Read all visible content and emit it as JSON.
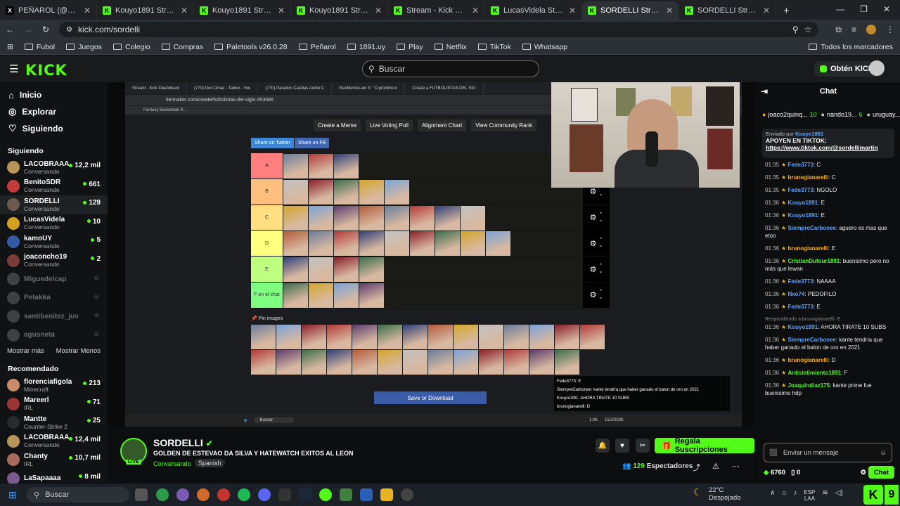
{
  "browser": {
    "tabs": [
      {
        "title": "PEÑAROL (@OficialCAP)",
        "fav": "X",
        "color": "#000"
      },
      {
        "title": "Kouyo1891 Stream - Watc",
        "fav": "K",
        "color": "#53fc18"
      },
      {
        "title": "Kouyo1891 Stream - Watc",
        "fav": "K",
        "color": "#53fc18"
      },
      {
        "title": "Kouyo1891 Stream - Watc",
        "fav": "K",
        "color": "#53fc18"
      },
      {
        "title": "Stream - Kick Dashboard",
        "fav": "K",
        "color": "#53fc18"
      },
      {
        "title": "LucasVidela Stream -",
        "fav": "K",
        "color": "#53fc18"
      },
      {
        "title": "SORDELLI Stream - W",
        "fav": "K",
        "color": "#53fc18"
      },
      {
        "title": "SORDELLI Stream - Kick D",
        "fav": "K",
        "color": "#53fc18"
      }
    ],
    "active_tab": 6,
    "url": "kick.com/sordelli",
    "bookmarks": [
      "Fubol",
      "Juegos",
      "Colegio",
      "Compras",
      "Paletools v26.0.28",
      "Peñarol",
      "1891.uy",
      "Play",
      "Netflix",
      "TikTok",
      "Whatsapp"
    ],
    "all_bookmarks": "Todos los marcadores"
  },
  "header": {
    "logo": "KICK",
    "search_placeholder": "Buscar",
    "get_kicks": "Obtén KICKs"
  },
  "sidebar": {
    "nav": [
      {
        "label": "Inicio",
        "icon": "home-icon"
      },
      {
        "label": "Explorar",
        "icon": "compass-icon"
      },
      {
        "label": "Siguiendo",
        "icon": "heart-icon"
      }
    ],
    "following_title": "Siguiendo",
    "following": [
      {
        "name": "LACOBRAAA",
        "sub": "Conversando",
        "viewers": "12,2 mil",
        "color": "#b79457"
      },
      {
        "name": "BenitoSDR",
        "sub": "Conversando",
        "viewers": "661",
        "color": "#c23b3b"
      },
      {
        "name": "SORDELLI",
        "sub": "Conversando",
        "viewers": "129",
        "color": "#6a5b4c"
      },
      {
        "name": "LucasVidela",
        "sub": "Conversando",
        "viewers": "10",
        "color": "#d3a21e"
      },
      {
        "name": "kamoUY",
        "sub": "Conversando",
        "viewers": "5",
        "color": "#3659a5"
      },
      {
        "name": "joaconcho19",
        "sub": "Conversando",
        "viewers": "2",
        "color": "#7a3c38"
      },
      {
        "name": "Miguedelcap",
        "sub": "",
        "viewers": "",
        "color": "#888"
      },
      {
        "name": "Petakka",
        "sub": "",
        "viewers": "",
        "color": "#888"
      },
      {
        "name": "santibenitez_juv",
        "sub": "",
        "viewers": "",
        "color": "#888"
      },
      {
        "name": "agusneta",
        "sub": "",
        "viewers": "",
        "color": "#888"
      }
    ],
    "show_more": "Mostrar más",
    "show_less": "Mostrar Menos",
    "recommended_title": "Recomendado",
    "recommended": [
      {
        "name": "florenciafigola",
        "sub": "Minecraft",
        "viewers": "213",
        "color": "#c88c6a"
      },
      {
        "name": "Mareerl",
        "sub": "IRL",
        "viewers": "71",
        "color": "#9b3434"
      },
      {
        "name": "Mantte",
        "sub": "Counter-Strike 2",
        "viewers": "25",
        "color": "#2a2a2a"
      },
      {
        "name": "LACOBRAAA",
        "sub": "Conversando",
        "viewers": "12,4 mil",
        "color": "#b79457"
      },
      {
        "name": "Chanty",
        "sub": "IRL",
        "viewers": "10,7 mil",
        "color": "#a66b5a"
      },
      {
        "name": "LaSapaaaa",
        "sub": "",
        "viewers": "8 mil",
        "color": "#7b5a8f"
      }
    ]
  },
  "stream_screen": {
    "tabs": [
      "Stream - Kick Dashboard",
      "(770) Don Omar - Taboo - You",
      "(770) Paradon Casillas Audio C",
      "GeoMemes en X: \"O próximo o",
      "Create a FUTBOLISTAS DEL SIG"
    ],
    "url": "tiermaker.com/create/futbolistas-del-siglo-353586",
    "bookmark": "Fantasy Basketball R...",
    "top_buttons": [
      "Create a Meme",
      "Live Voting Poll",
      "Alignment Chart",
      "View Community Rank"
    ],
    "share": [
      "Share on Twitter",
      "Share on FB"
    ],
    "tiers": [
      {
        "label": "A",
        "color": "#ff7f7f",
        "count": 3
      },
      {
        "label": "B",
        "color": "#ffbf7f",
        "count": 5
      },
      {
        "label": "C",
        "color": "#ffdf7f",
        "count": 8
      },
      {
        "label": "D",
        "color": "#ffff7f",
        "count": 9
      },
      {
        "label": "E",
        "color": "#bfff7f",
        "count": 4
      },
      {
        "label": "F en el chat",
        "color": "#7fff7f",
        "count": 4
      }
    ],
    "pin_images": "Pin images",
    "save_button": "Save or Download",
    "mini_chat": [
      "Fede3773: E",
      "SiempreCarbonee: kante tendría que haber ganado el balon de oro en 2021",
      "Kouyo1891: AHORA TIRATE 10 SUBS",
      "brunogianarelli: D"
    ],
    "taskbar_search": "Buscar",
    "clock": "1:36",
    "date": "15/2/2026"
  },
  "stream_info": {
    "name": "SORDELLI",
    "title": "GOLDEN DE ESTEVAO DA SILVA Y HATEWATCH EXITOS AL LEON",
    "category": "Conversando",
    "language": "Spanish",
    "live": "LIVE",
    "subscribe": "Regala Suscripciones",
    "viewers": "129",
    "viewers_label": "Espectadores"
  },
  "chat": {
    "title": "Chat",
    "gifters": [
      {
        "name": "joaco2quinq...",
        "count": "10"
      },
      {
        "name": "nando19...",
        "count": "6"
      },
      {
        "name": "uruguay...",
        "count": "3"
      }
    ],
    "pinned_by": "Enviado por",
    "pinned_user": "Kouyo1891",
    "pinned_text": "APOYEN EN TIKTOK:",
    "pinned_link": "https://www.tiktok.com/@sordellimartin",
    "messages": [
      {
        "t": "01:35",
        "u": "Fede3773",
        "c": "#5ea3ff",
        "m": "C"
      },
      {
        "t": "01:35",
        "u": "brunogianarelli",
        "c": "#ffb020",
        "m": "C"
      },
      {
        "t": "01:35",
        "u": "Fede3773",
        "c": "#5ea3ff",
        "m": "NGOLO"
      },
      {
        "t": "01:36",
        "u": "Kouyo1891",
        "c": "#5ea3ff",
        "m": "E"
      },
      {
        "t": "01:36",
        "u": "Kouyo1891",
        "c": "#5ea3ff",
        "m": "E"
      },
      {
        "t": "01:36",
        "u": "SiempreCarbonee",
        "c": "#5ea3ff",
        "m": "aguero es mas que etoo"
      },
      {
        "t": "01:36",
        "u": "brunogianarelli",
        "c": "#ffb020",
        "m": "E"
      },
      {
        "t": "01:36",
        "u": "CristianDufour1891",
        "c": "#53fc18",
        "m": "buenisimo pero no más que lewan"
      },
      {
        "t": "01:36",
        "u": "Fede3773",
        "c": "#5ea3ff",
        "m": "NAAAA"
      },
      {
        "t": "01:36",
        "u": "Nxo74",
        "c": "#5ea3ff",
        "m": "PEDOFILO"
      },
      {
        "t": "01:36",
        "u": "Fede3773",
        "c": "#5ea3ff",
        "m": "E"
      },
      {
        "t": "01:36",
        "u": "Kouyo1891",
        "c": "#5ea3ff",
        "m": "AHORA TIRATE 10 SUBS",
        "reply": "Respondiendo a brunogianarelli: E"
      },
      {
        "t": "01:36",
        "u": "SiempreCarbonee",
        "c": "#5ea3ff",
        "m": "kante tendría que haber ganado el balon de oro en 2021"
      },
      {
        "t": "01:36",
        "u": "brunogianarelli",
        "c": "#ffb020",
        "m": "D"
      },
      {
        "t": "01:36",
        "u": "Antisietimiento1891",
        "c": "#53fc18",
        "m": "F"
      },
      {
        "t": "01:36",
        "u": "Joaquindiaz175",
        "c": "#53fc18",
        "m": "kante prime fue buenisimo hdp"
      }
    ],
    "input_placeholder": "Enviar un mensaje",
    "kicks": "6760",
    "subs": "0",
    "chat_button": "Chat"
  },
  "taskbar": {
    "search": "Buscar",
    "temp": "22°C",
    "weather": "Despejado",
    "lang": "ESP",
    "lang2": "LAA"
  }
}
